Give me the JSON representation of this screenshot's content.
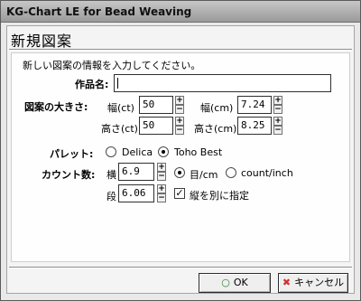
{
  "window": {
    "title": "KG-Chart LE for Bead Weaving"
  },
  "dialog": {
    "heading": "新規図案",
    "instruction": "新しい図案の情報を入力してください。"
  },
  "form": {
    "name_label": "作品名:",
    "name_value": "",
    "size_label": "図案の大きさ:",
    "width_ct_label": "幅(ct)",
    "width_ct_value": "50",
    "width_cm_label": "幅(cm)",
    "width_cm_value": "7.24",
    "height_ct_label": "高さ(ct)",
    "height_ct_value": "50",
    "height_cm_label": "高さ(cm)",
    "height_cm_value": "8.25",
    "palette_label": "パレット:",
    "palette_options": [
      "Delica",
      "Toho Best"
    ],
    "palette_selected": "Toho Best",
    "count_label": "カウント数:",
    "horizontal_label": "横",
    "horizontal_value": "6.9",
    "vertical_label": "段",
    "vertical_value": "6.06",
    "unit_options": [
      "目/cm",
      "count/inch"
    ],
    "unit_selected": "目/cm",
    "separate_label": "縦を別に指定",
    "separate_checked": true
  },
  "buttons": {
    "ok_label": "OK",
    "cancel_label": "キャンセル"
  },
  "colors": {
    "ok_icon": "#2e7d32",
    "cancel_icon": "#d32f2f"
  }
}
